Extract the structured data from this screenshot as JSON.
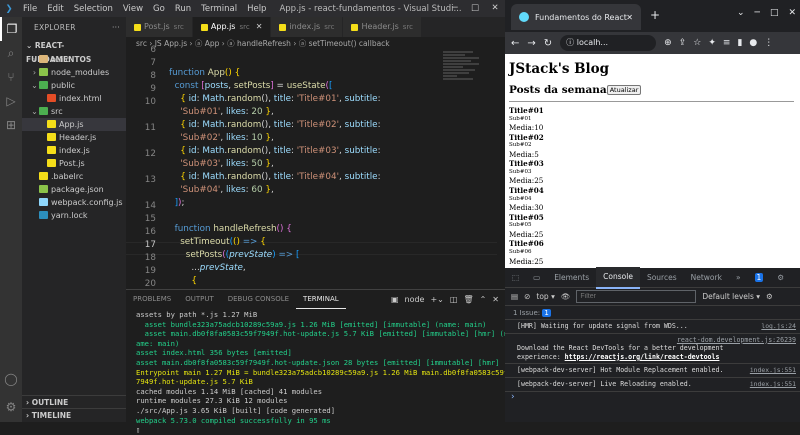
{
  "vscode": {
    "menu": [
      "File",
      "Edit",
      "Selection",
      "View",
      "Go",
      "Run",
      "Terminal",
      "Help"
    ],
    "window_title": "App.js - react-fundamentos - Visual Studi...",
    "sidebar": {
      "title": "EXPLORER",
      "root": "REACT-FUNDAMENTOS",
      "items": [
        {
          "label": "build",
          "type": "folder",
          "open": false,
          "depth": 1,
          "color": "#dcb67a"
        },
        {
          "label": "node_modules",
          "type": "folder",
          "open": false,
          "depth": 1,
          "color": "#8bc34a"
        },
        {
          "label": "public",
          "type": "folder",
          "open": true,
          "depth": 1,
          "color": "#4caf50"
        },
        {
          "label": "index.html",
          "type": "file",
          "depth": 2,
          "color": "#e44d26"
        },
        {
          "label": "src",
          "type": "folder",
          "open": true,
          "depth": 1,
          "color": "#4caf50"
        },
        {
          "label": "App.js",
          "type": "file",
          "depth": 2,
          "color": "#f5de19",
          "selected": true
        },
        {
          "label": "Header.js",
          "type": "file",
          "depth": 2,
          "color": "#f5de19"
        },
        {
          "label": "index.js",
          "type": "file",
          "depth": 2,
          "color": "#f5de19"
        },
        {
          "label": "Post.js",
          "type": "file",
          "depth": 2,
          "color": "#f5de19"
        },
        {
          "label": ".babelrc",
          "type": "file",
          "depth": 1,
          "color": "#f5de19"
        },
        {
          "label": "package.json",
          "type": "file",
          "depth": 1,
          "color": "#8bc34a"
        },
        {
          "label": "webpack.config.js",
          "type": "file",
          "depth": 1,
          "color": "#8ed6fb"
        },
        {
          "label": "yarn.lock",
          "type": "file",
          "depth": 1,
          "color": "#2c8ebb"
        }
      ],
      "outline": "OUTLINE",
      "timeline": "TIMELINE"
    },
    "tabs": [
      {
        "label": "Post.js",
        "src": "src",
        "active": false
      },
      {
        "label": "App.js",
        "src": "src",
        "active": true
      },
      {
        "label": "index.js",
        "src": "src",
        "active": false
      },
      {
        "label": "Header.js",
        "src": "src",
        "active": false
      }
    ],
    "breadcrumb": "src  ›  JS App.js  ›  ⓐ App  ›  ⓐ handleRefresh  ›  ⓐ setTimeout() callback",
    "line_numbers": [
      "6",
      "7",
      "8",
      "9",
      "10",
      "",
      "11",
      "",
      "12",
      "",
      "13",
      "",
      "14",
      "15",
      "16",
      "17",
      "18",
      "19",
      "20",
      "21"
    ],
    "terminal_tabs": [
      "PROBLEMS",
      "OUTPUT",
      "DEBUG CONSOLE",
      "TERMINAL"
    ],
    "terminal_shell": "node",
    "terminal_lines": [
      "assets by path *.js 1.27 MiB",
      "  asset bundle323a75adcb10289c59a9.js 1.26 MiB [emitted] [immutable] (name: main)",
      "  asset main.db0f8fa0583c59f7949f.hot-update.js 5.7 KiB [emitted] [immutable] [hmr] (n",
      "ame: main)",
      "asset index.html 356 bytes [emitted]",
      "asset main.db0f8fa0583c59f7949f.hot-update.json 28 bytes [emitted] [immutable] [hmr]",
      "Entrypoint main 1.27 MiB = bundle323a75adcb10289c59a9.js 1.26 MiB main.db0f8fa0583c59f",
      "7949f.hot-update.js 5.7 KiB",
      "cached modules 1.14 MiB [cached] 41 modules",
      "runtime modules 27.3 KiB 12 modules",
      "./src/App.js 3.65 KiB [built] [code generated]",
      "webpack 5.73.0 compiled successfully in 95 ms"
    ]
  },
  "browser": {
    "tab_title": "Fundamentos do React",
    "url": "localh...",
    "page": {
      "heading": "JStack's Blog",
      "subheading": "Posts da semana",
      "refresh_button": "Atualizar",
      "posts": [
        {
          "title": "Title#01",
          "subtitle": "Sub#01",
          "media": "Media:10"
        },
        {
          "title": "Title#02",
          "subtitle": "Sub#02",
          "media": "Media:5"
        },
        {
          "title": "Title#03",
          "subtitle": "Sub#03",
          "media": "Media:25"
        },
        {
          "title": "Title#04",
          "subtitle": "Sub#04",
          "media": "Media:30"
        },
        {
          "title": "Title#05",
          "subtitle": "Sub#05",
          "media": "Media:25"
        },
        {
          "title": "Title#06",
          "subtitle": "Sub#06",
          "media": "Media:25"
        }
      ]
    },
    "devtools": {
      "tabs": [
        "Elements",
        "Console",
        "Sources",
        "Network"
      ],
      "issue_badge": "1",
      "context": "top",
      "filter_placeholder": "Filter",
      "levels": "Default levels",
      "issues_label": "1 Issue:",
      "issues_count": "1",
      "messages": [
        {
          "text": "[HMR] Waiting for update signal from WDS...",
          "source": "log.js:24"
        },
        {
          "source_top": "react-dom.development.js:26239",
          "text": "Download the React DevTools for a better development experience: ",
          "link": "https://reactjs.org/link/react-devtools"
        },
        {
          "text": "[webpack-dev-server] Hot Module Replacement enabled.",
          "source": "index.js:551"
        },
        {
          "text": "[webpack-dev-server] Live Reloading enabled.",
          "source": "index.js:551"
        }
      ]
    }
  }
}
